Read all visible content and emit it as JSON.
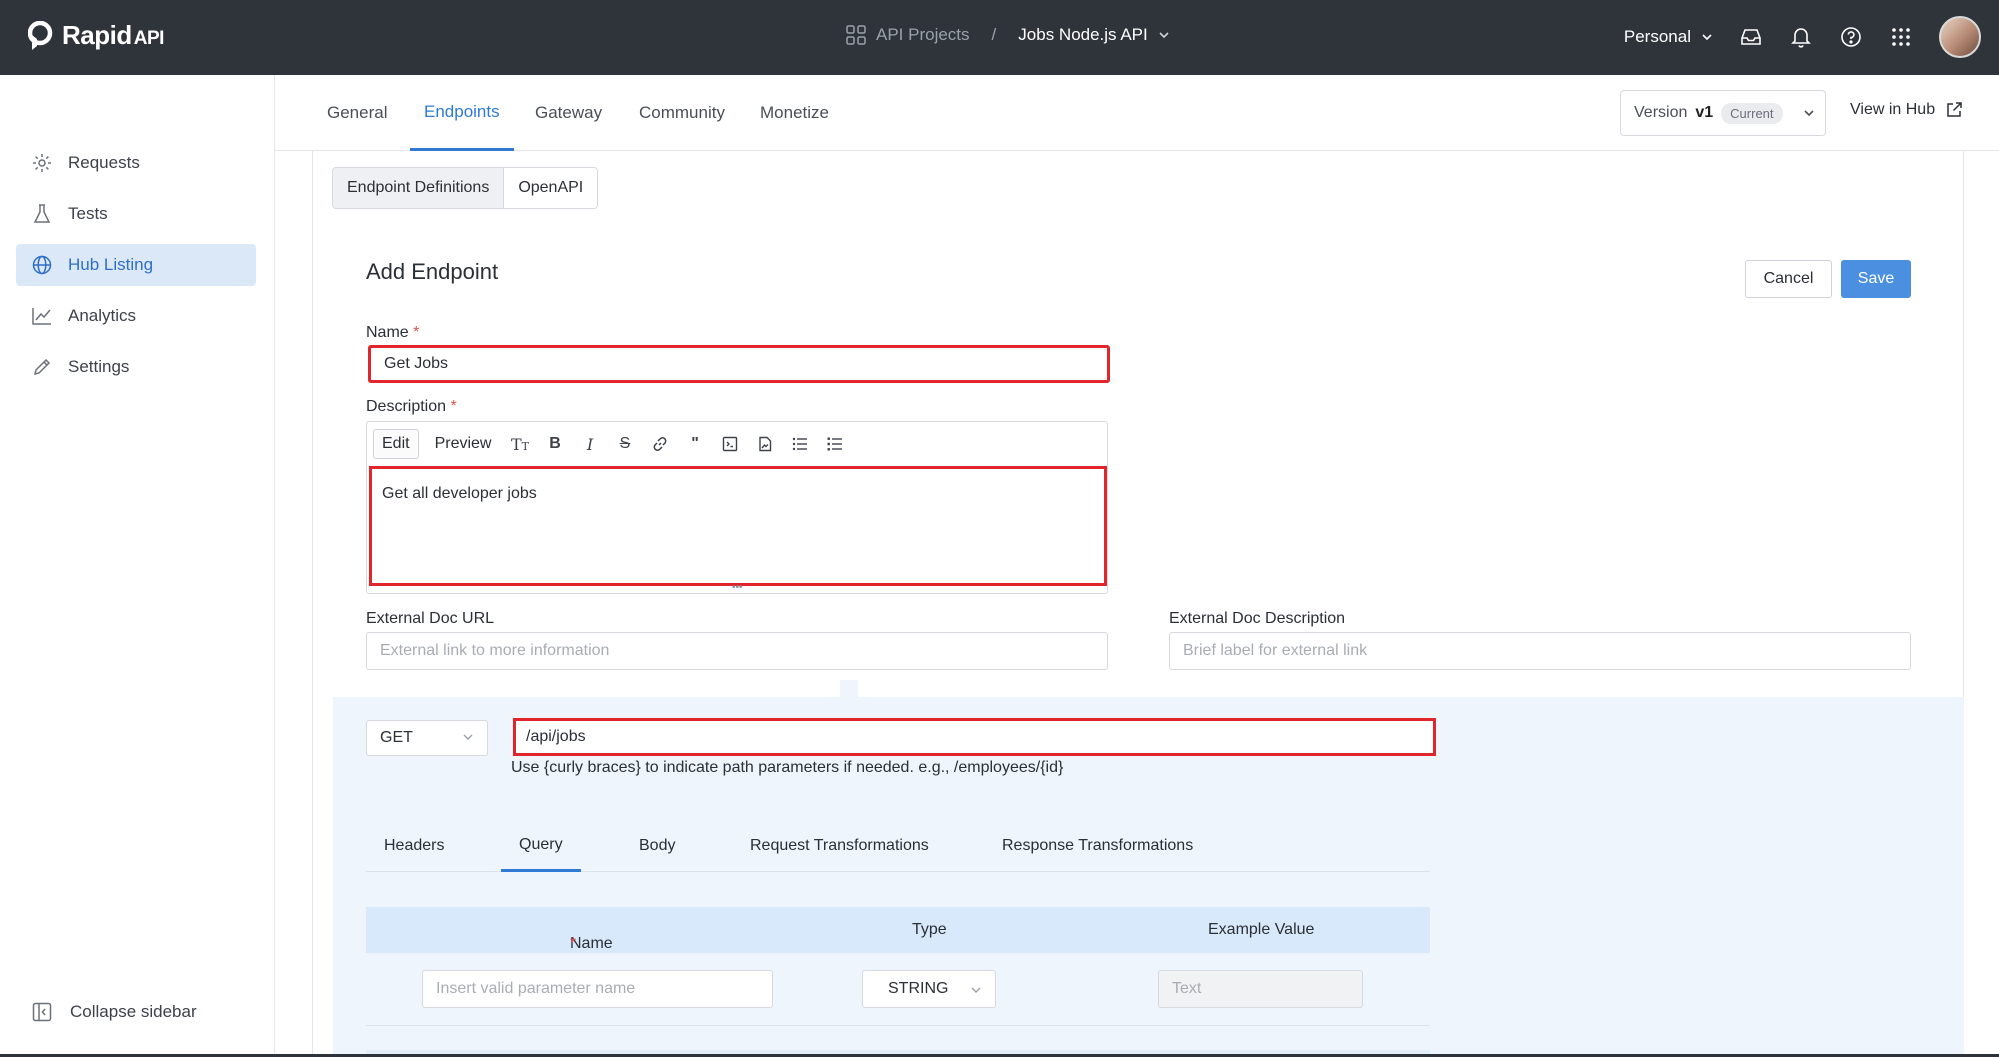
{
  "app": {
    "logo_text": "Rapid",
    "logo_suffix": "API",
    "breadcrumb_projects": "API Projects",
    "breadcrumb_separator": "/",
    "breadcrumb_current": "Jobs Node.js API",
    "workspace": "Personal"
  },
  "sidebar": {
    "items": [
      {
        "label": "Requests",
        "icon": "requests-icon"
      },
      {
        "label": "Tests",
        "icon": "flask-icon"
      },
      {
        "label": "Hub Listing",
        "icon": "globe-icon",
        "active": true
      },
      {
        "label": "Analytics",
        "icon": "chart-icon"
      },
      {
        "label": "Settings",
        "icon": "pencil-icon"
      }
    ],
    "collapse_label": "Collapse sidebar"
  },
  "tabs": {
    "items": [
      "General",
      "Endpoints",
      "Gateway",
      "Community",
      "Monetize"
    ],
    "active": "Endpoints"
  },
  "version": {
    "prefix": "Version",
    "value": "v1",
    "badge": "Current"
  },
  "view_hub_label": "View in Hub",
  "segments": {
    "definitions": "Endpoint Definitions",
    "openapi": "OpenAPI"
  },
  "form": {
    "title": "Add Endpoint",
    "cancel": "Cancel",
    "save": "Save",
    "name_label": "Name",
    "name_value": "Get Jobs",
    "description_label": "Description",
    "required_mark": "*",
    "toolbar_edit": "Edit",
    "toolbar_preview": "Preview",
    "description_value": "Get all developer jobs",
    "ext_url_label": "External Doc URL",
    "ext_url_placeholder": "External link to more information",
    "ext_desc_label": "External Doc Description",
    "ext_desc_placeholder": "Brief label for external link"
  },
  "request": {
    "method": "GET",
    "path": "/api/jobs",
    "hint": "Use {curly braces} to indicate path parameters if needed. e.g., /employees/{id}"
  },
  "param_tabs": {
    "items": [
      "Headers",
      "Query",
      "Body",
      "Request Transformations",
      "Response Transformations"
    ],
    "active": "Query"
  },
  "param_table": {
    "columns": [
      "Name",
      "Type",
      "Example Value"
    ],
    "name_placeholder": "Insert valid parameter name",
    "type_value": "STRING",
    "example_placeholder": "Text"
  },
  "colors": {
    "topbar": "#2f343b",
    "accent": "#2f7bd4",
    "highlight": "#e0262b",
    "save_button": "#4a8fe0"
  }
}
